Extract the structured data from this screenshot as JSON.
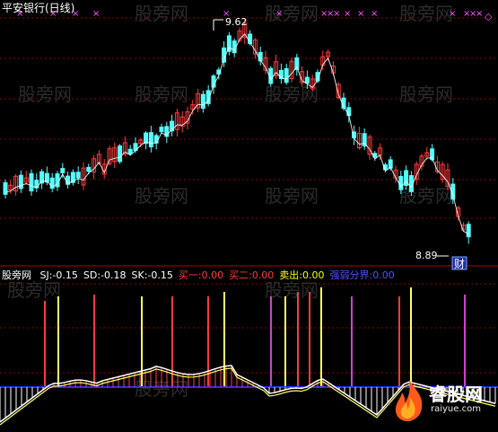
{
  "window": {
    "title": "平安银行(日线)"
  },
  "price_panel": {
    "high_label": "9.62",
    "low_label": "8.89",
    "finance_badge": "财",
    "colors": {
      "up": "#ff3b3b",
      "down": "#54ffff",
      "ma": "#ffffff",
      "marker": "#ff55ff",
      "grid": "#8b0000"
    }
  },
  "indicator_panel": {
    "name": "股旁网",
    "fields": [
      {
        "label": "SJ:",
        "value": "-0.15",
        "color": "#ffffff"
      },
      {
        "label": "SD:",
        "value": "-0.18",
        "color": "#ffffff"
      },
      {
        "label": "SK:",
        "value": "-0.15",
        "color": "#ffffff"
      },
      {
        "label": "买一:",
        "value": "0.00",
        "color": "#ff3b3b"
      },
      {
        "label": "买二:",
        "value": "0.00",
        "color": "#ff3b3b"
      },
      {
        "label": "卖出:",
        "value": "0.00",
        "color": "#ffff00"
      },
      {
        "label": "强弱分界:",
        "value": "0.00",
        "color": "#5050ff"
      }
    ],
    "colors": {
      "buy": "#ff3b3b",
      "sell": "#ffff66",
      "purple": "#cc44cc",
      "zero": "#2030ff",
      "curve": "#ffffff",
      "curve2": "#ffff66"
    }
  },
  "watermark": {
    "text": "股旁网"
  },
  "brand": {
    "name": "睿股网",
    "url": "raiyue.com"
  }
}
